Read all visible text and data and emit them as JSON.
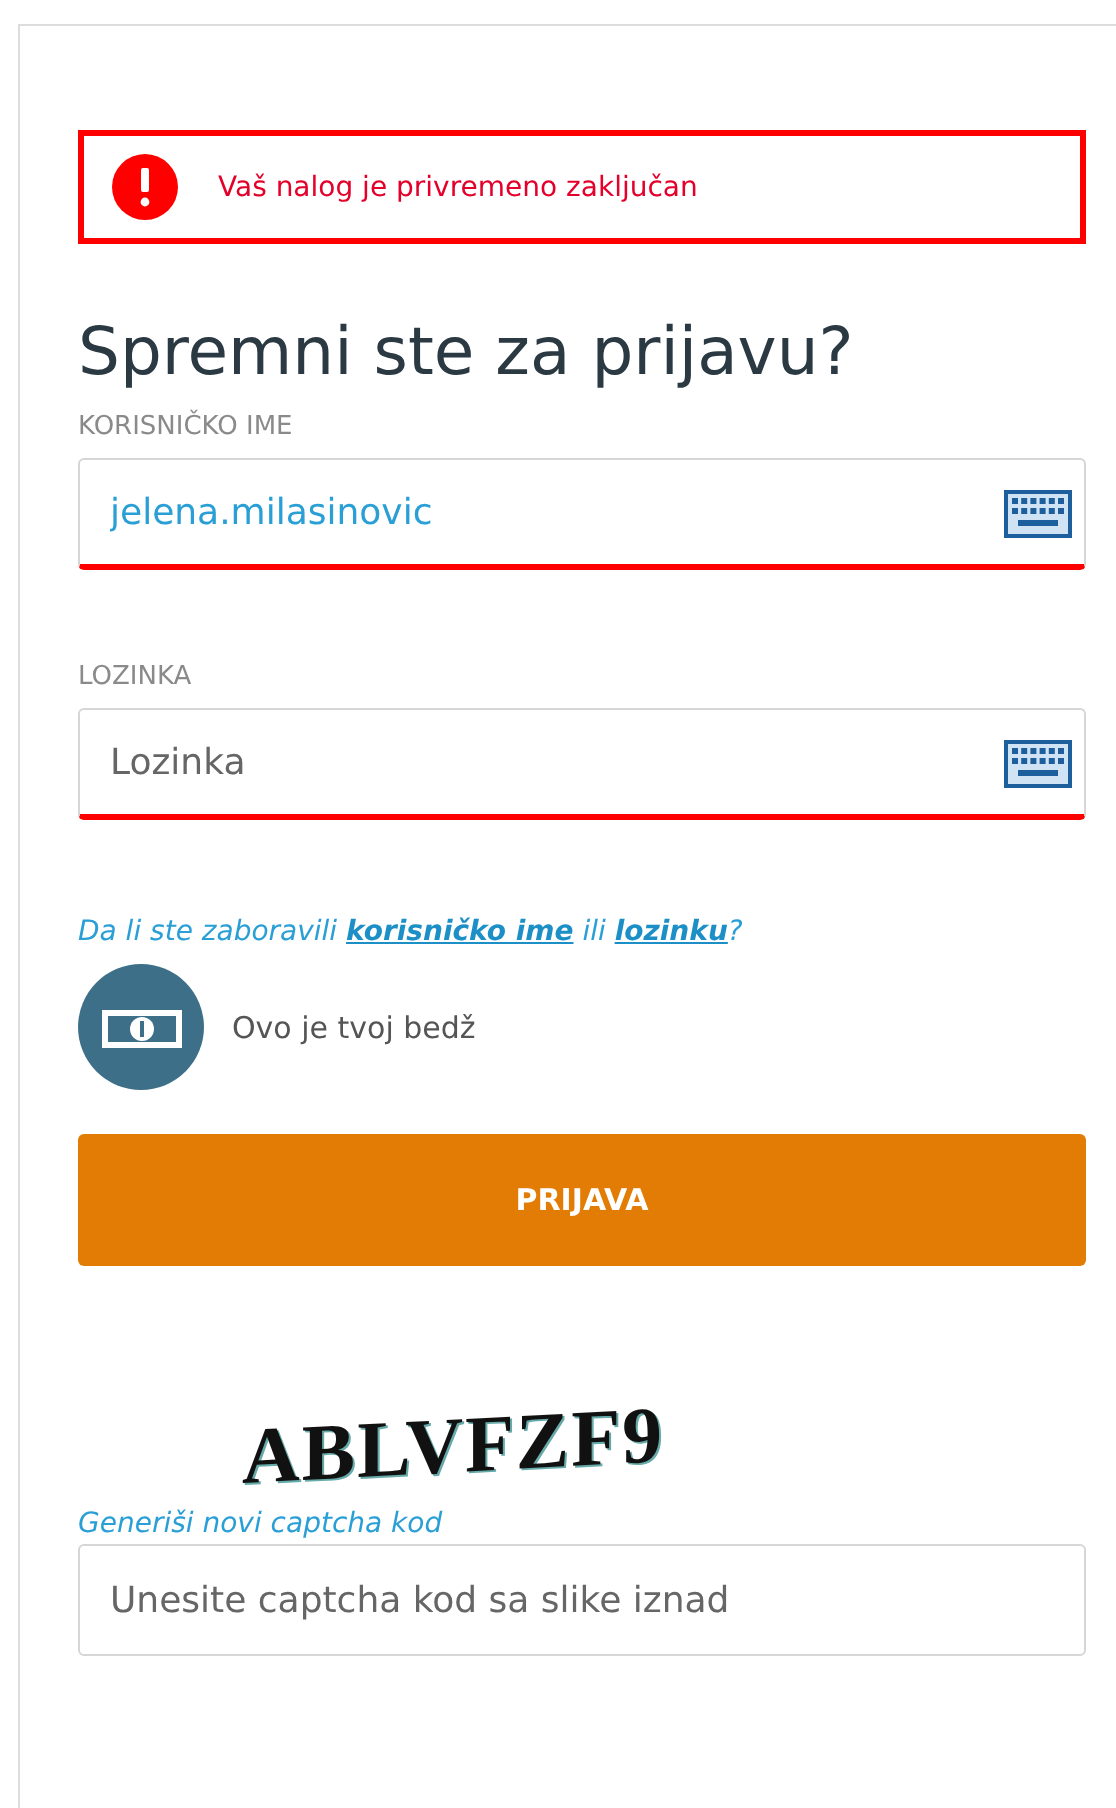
{
  "alert": {
    "message": "Vaš nalog je privremeno zaključan"
  },
  "heading": "Spremni ste za prijavu?",
  "fields": [
    {
      "label": "KORISNIČKO IME",
      "value": "jelena.milasinovic",
      "error": true,
      "keyboard": true
    },
    {
      "label": "LOZINKA",
      "placeholder": "Lozinka",
      "error": true,
      "keyboard": true
    }
  ],
  "forgot": {
    "prefix": "Da li ste zaboravili",
    "username_link": "korisničko ime",
    "middle": "ili",
    "password_link": "lozinku",
    "suffix": "?"
  },
  "badge": {
    "text": "Ovo je tvoj bedž"
  },
  "login_button": "PRIJAVA",
  "captcha": {
    "image_text": "ABLVFZF9",
    "regenerate_link": "Generiši novi captcha kod",
    "placeholder": "Unesite captcha kod sa slike iznad",
    "error": false
  }
}
